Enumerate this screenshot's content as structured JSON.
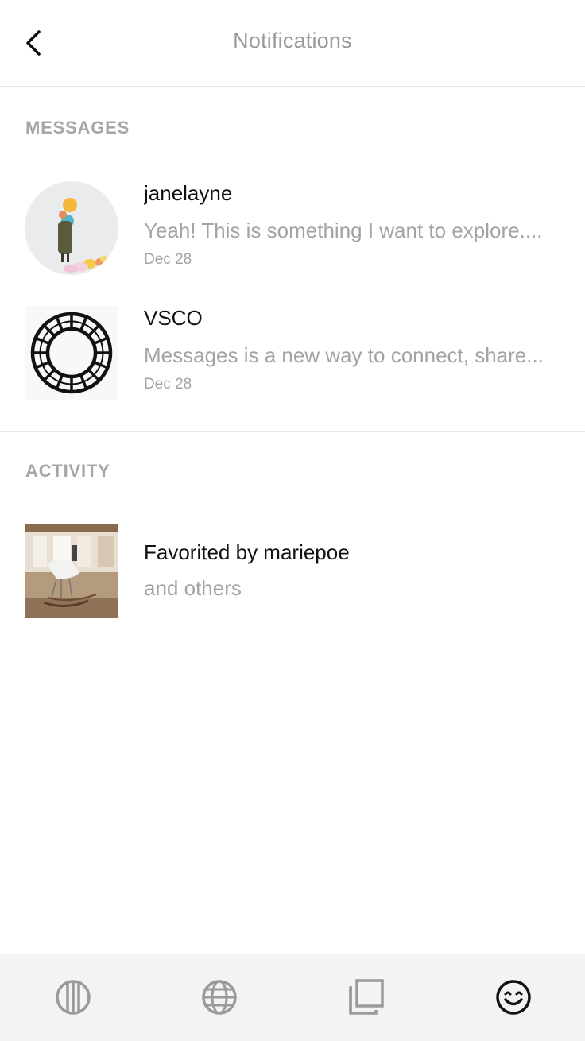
{
  "header": {
    "title": "Notifications"
  },
  "messages": {
    "section_label": "MESSAGES",
    "items": [
      {
        "name": "janelayne",
        "preview": "Yeah! This is something I want to explore....",
        "date": "Dec 28",
        "avatar_icon": "user-photo-avatar"
      },
      {
        "name": "VSCO",
        "preview": "Messages is a new way to connect, share...",
        "date": "Dec 28",
        "avatar_icon": "vsco-logo-icon"
      }
    ]
  },
  "activity": {
    "section_label": "ACTIVITY",
    "items": [
      {
        "title": "Favorited by mariepoe",
        "subtitle": "and others",
        "thumbnail_icon": "rocking-chair-photo"
      }
    ]
  },
  "tabbar": {
    "tabs": [
      {
        "icon": "studio-icon",
        "active": false
      },
      {
        "icon": "globe-icon",
        "active": false
      },
      {
        "icon": "library-icon",
        "active": false
      },
      {
        "icon": "smiley-icon",
        "active": true
      }
    ]
  },
  "colors": {
    "header_title": "#9a9a9a",
    "section_label": "#a6a6a6",
    "primary_text": "#111111",
    "secondary_text": "#a3a3a3",
    "divider": "#e6e6e6",
    "tabbar_bg": "#f3f3f3",
    "inactive_icon": "#9a9a9a",
    "active_icon": "#111111"
  }
}
